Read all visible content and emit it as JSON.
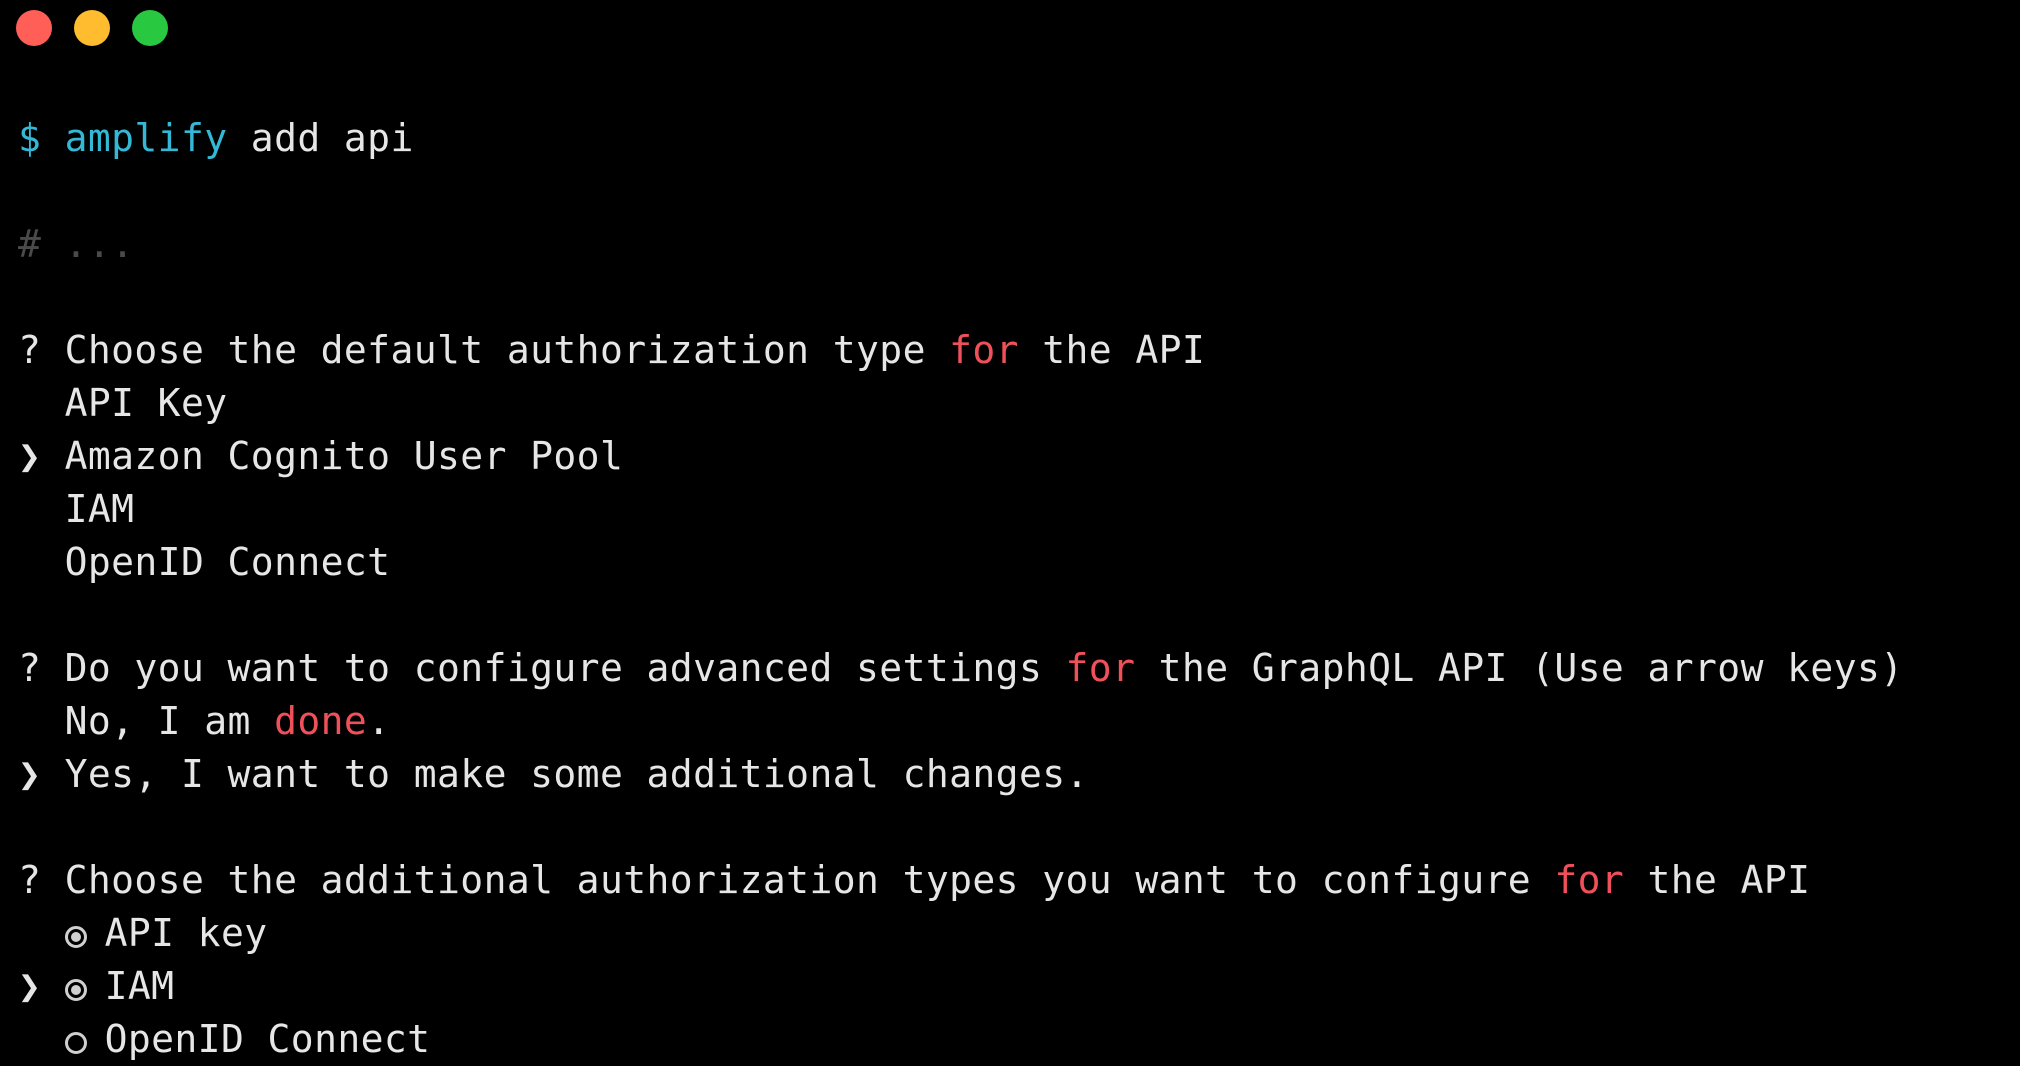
{
  "window": {
    "controls": [
      {
        "name": "close",
        "color": "#ff5f57"
      },
      {
        "name": "minimize",
        "color": "#febc2e"
      },
      {
        "name": "maximize",
        "color": "#28c840"
      }
    ]
  },
  "terminal": {
    "prompt_symbol": "$",
    "command_name": "amplify",
    "command_args": " add api",
    "comment": "# ...",
    "q1": {
      "marker": "?",
      "text_before": "Choose the default authorization type ",
      "keyword": "for",
      "text_after": " the API",
      "pointer": "❯",
      "options": [
        "API Key",
        "Amazon Cognito User Pool",
        "IAM",
        "OpenID Connect"
      ],
      "selected_index": 1
    },
    "q2": {
      "marker": "?",
      "text_before": "Do you want to configure advanced settings ",
      "keyword": "for",
      "text_after": " the GraphQL API (Use arrow keys)",
      "pointer": "❯",
      "option1_before": "No, I am ",
      "option1_keyword": "done",
      "option1_after": ".",
      "option2": "Yes, I want to make some additional changes."
    },
    "q3": {
      "marker": "?",
      "text_before": "Choose the additional authorization types you want to configure ",
      "keyword": "for",
      "text_after": " the API",
      "pointer": "❯",
      "options": [
        {
          "label": "API key",
          "checked": true
        },
        {
          "label": "IAM",
          "checked": true
        },
        {
          "label": "OpenID Connect",
          "checked": false
        }
      ]
    },
    "colors": {
      "command": "#33b8d6",
      "keyword": "#f0505a",
      "comment": "#4a4a4a",
      "text": "#e6e6e6"
    }
  }
}
